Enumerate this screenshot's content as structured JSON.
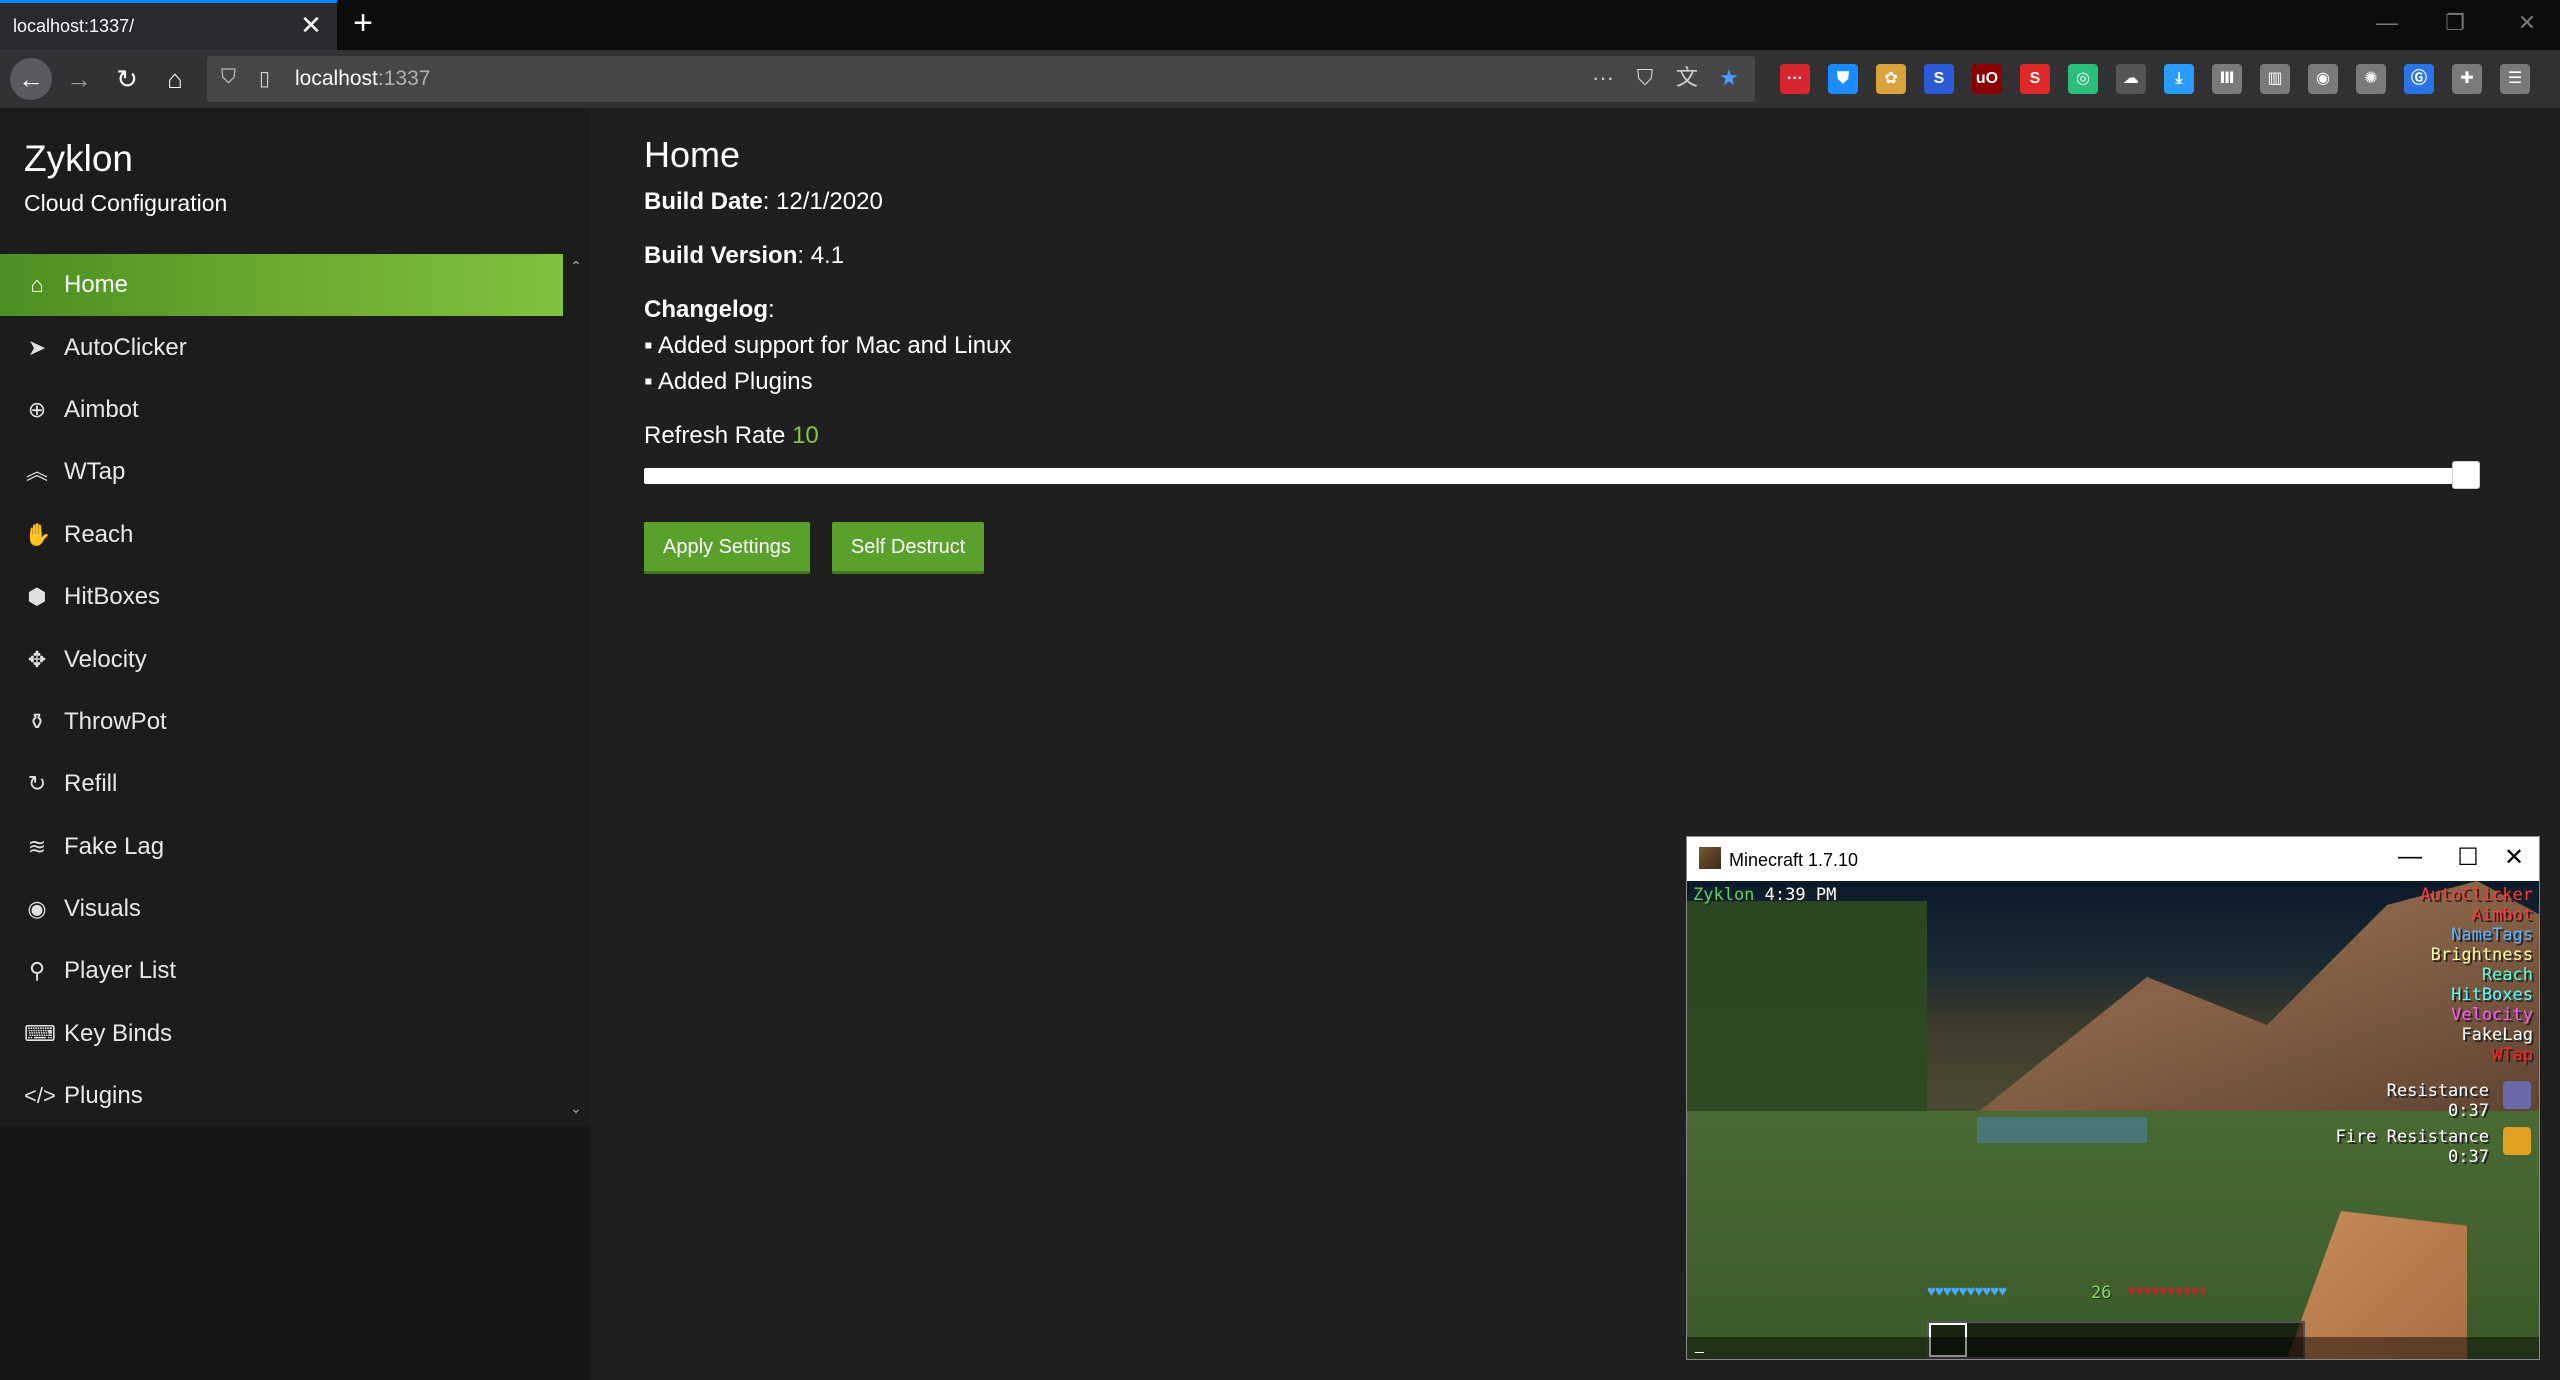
{
  "browser": {
    "tab_title": "localhost:1337/",
    "tab_close": "✕",
    "new_tab": "+",
    "url_host": "localhost",
    "url_port": ":1337",
    "window_controls": [
      "—",
      "❐",
      "✕"
    ],
    "nav_icons": [
      "back-arrow-icon",
      "forward-arrow-icon",
      "reload-icon",
      "home-icon"
    ],
    "url_actions": [
      "more-icon",
      "pocket-icon",
      "translate-icon",
      "bookmark-star-icon"
    ],
    "extensions": [
      {
        "name": "ext-dots-icon",
        "glyph": "···",
        "color": "#d7262e"
      },
      {
        "name": "ext-bitwarden-icon",
        "glyph": "⛊",
        "color": "#1a8cff"
      },
      {
        "name": "ext-users-icon",
        "glyph": "✿",
        "color": "#d9a23a"
      },
      {
        "name": "ext-s-circle-icon",
        "glyph": "S",
        "color": "#2c5bd8"
      },
      {
        "name": "ext-ublock-icon",
        "glyph": "uO",
        "color": "#8b0000"
      },
      {
        "name": "ext-s-red-icon",
        "glyph": "S",
        "color": "#e02828"
      },
      {
        "name": "ext-sync-icon",
        "glyph": "◎",
        "color": "#2bbf7a"
      },
      {
        "name": "ext-ghost-icon",
        "glyph": "☁",
        "color": "#555555"
      },
      {
        "name": "download-icon",
        "glyph": "⤓",
        "color": "#2a9cff"
      },
      {
        "name": "library-icon",
        "glyph": "Ⅲ",
        "color": "#7a7a7a"
      },
      {
        "name": "sidebar-icon",
        "glyph": "▥",
        "color": "#7a7a7a"
      },
      {
        "name": "account-icon",
        "glyph": "◉",
        "color": "#7a7a7a"
      },
      {
        "name": "cookie-icon",
        "glyph": "✺",
        "color": "#7a7a7a"
      },
      {
        "name": "translate-ext-icon",
        "glyph": "Ⓖ",
        "color": "#2a73e8"
      },
      {
        "name": "extensions-icon",
        "glyph": "✚",
        "color": "#7a7a7a"
      },
      {
        "name": "menu-icon",
        "glyph": "☰",
        "color": "#7a7a7a"
      }
    ]
  },
  "sidebar": {
    "title": "Zyklon",
    "subtitle": "Cloud Configuration",
    "items": [
      {
        "label": "Home",
        "icon": "home-icon",
        "glyph": "⌂",
        "active": true
      },
      {
        "label": "AutoClicker",
        "icon": "cursor-icon",
        "glyph": "➤"
      },
      {
        "label": "Aimbot",
        "icon": "crosshair-icon",
        "glyph": "⊕"
      },
      {
        "label": "WTap",
        "icon": "double-chevron-up-icon",
        "glyph": "︽"
      },
      {
        "label": "Reach",
        "icon": "hand-icon",
        "glyph": "✋"
      },
      {
        "label": "HitBoxes",
        "icon": "cube-icon",
        "glyph": "⬢"
      },
      {
        "label": "Velocity",
        "icon": "arrows-move-icon",
        "glyph": "✥"
      },
      {
        "label": "ThrowPot",
        "icon": "potion-icon",
        "glyph": "⚱"
      },
      {
        "label": "Refill",
        "icon": "refresh-icon",
        "glyph": "↻"
      },
      {
        "label": "Fake Lag",
        "icon": "wifi-icon",
        "glyph": "≋"
      },
      {
        "label": "Visuals",
        "icon": "eye-icon",
        "glyph": "◉"
      },
      {
        "label": "Player List",
        "icon": "user-icon",
        "glyph": "⚲"
      },
      {
        "label": "Key Binds",
        "icon": "keyboard-icon",
        "glyph": "⌨"
      },
      {
        "label": "Plugins",
        "icon": "code-icon",
        "glyph": "</>"
      }
    ],
    "scroll_up": "⌃",
    "scroll_down": "⌄"
  },
  "main": {
    "title": "Home",
    "build_date_label": "Build Date",
    "build_date_value": ": 12/1/2020",
    "build_version_label": "Build Version",
    "build_version_value": ": 4.1",
    "changelog_label": "Changelog",
    "changelog_colon": ":",
    "changelog": [
      "▪ Added support for Mac and Linux",
      "▪ Added Plugins"
    ],
    "refresh_rate_label": "Refresh Rate",
    "refresh_rate_value": "10",
    "apply_button": "Apply Settings",
    "destruct_button": "Self Destruct",
    "accent": "#5aa02c"
  },
  "minecraft": {
    "window_title": "Minecraft 1.7.10",
    "controls": [
      "—",
      "☐",
      "✕"
    ],
    "hud_brand": "Zyklon",
    "hud_time": "4:39 PM",
    "modules": [
      {
        "name": "AutoClicker",
        "color": "#ff3a3a"
      },
      {
        "name": "Aimbot",
        "color": "#ff3a3a"
      },
      {
        "name": "NameTags",
        "color": "#5ab4ff"
      },
      {
        "name": "Brightness",
        "color": "#ffffa0"
      },
      {
        "name": "Reach",
        "color": "#5affd8"
      },
      {
        "name": "HitBoxes",
        "color": "#5affff"
      },
      {
        "name": "Velocity",
        "color": "#ff5aff"
      },
      {
        "name": "FakeLag",
        "color": "#ffffff"
      },
      {
        "name": "WTap",
        "color": "#ff2020"
      }
    ],
    "effects": [
      {
        "name": "Resistance",
        "time": "0:37",
        "icon": "resistance-effect-icon",
        "color": "#6a6aaa"
      },
      {
        "name": "Fire Resistance",
        "time": "0:37",
        "icon": "fire-resistance-effect-icon",
        "color": "#e0a020"
      }
    ],
    "health": "♥♥♥♥♥♥♥♥♥♥",
    "level": "26",
    "armor": "♥♥♥♥♥♥♥♥♥♥",
    "chat_cursor": "_"
  }
}
